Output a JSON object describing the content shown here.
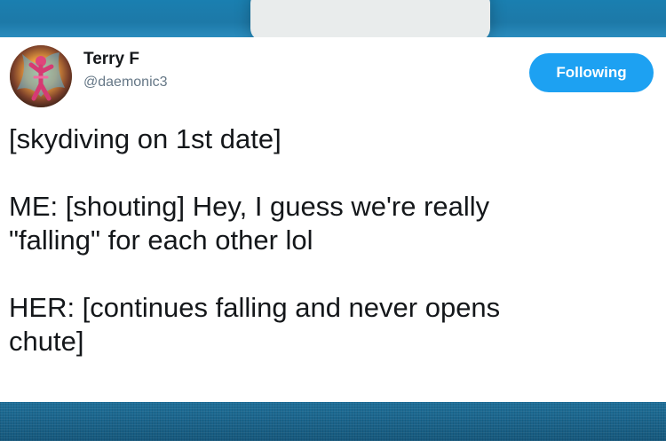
{
  "tweet": {
    "author": {
      "name": "Terry F",
      "handle": "@daemonic3"
    },
    "follow_button_label": "Following",
    "lines": {
      "line1": "[skydiving on 1st date]",
      "line2": "ME: [shouting] Hey, I guess we're really",
      "line3": "\"falling\" for each other lol",
      "line4": "HER: [continues falling and never opens",
      "line5": "chute]"
    }
  },
  "colors": {
    "follow_button": "#1da1f2",
    "name_text": "#14171a",
    "handle_text": "#657786",
    "card_background": "#ffffff",
    "page_background": "#1f6a93"
  },
  "icons": {
    "avatar": "avatar-figure-icon"
  }
}
